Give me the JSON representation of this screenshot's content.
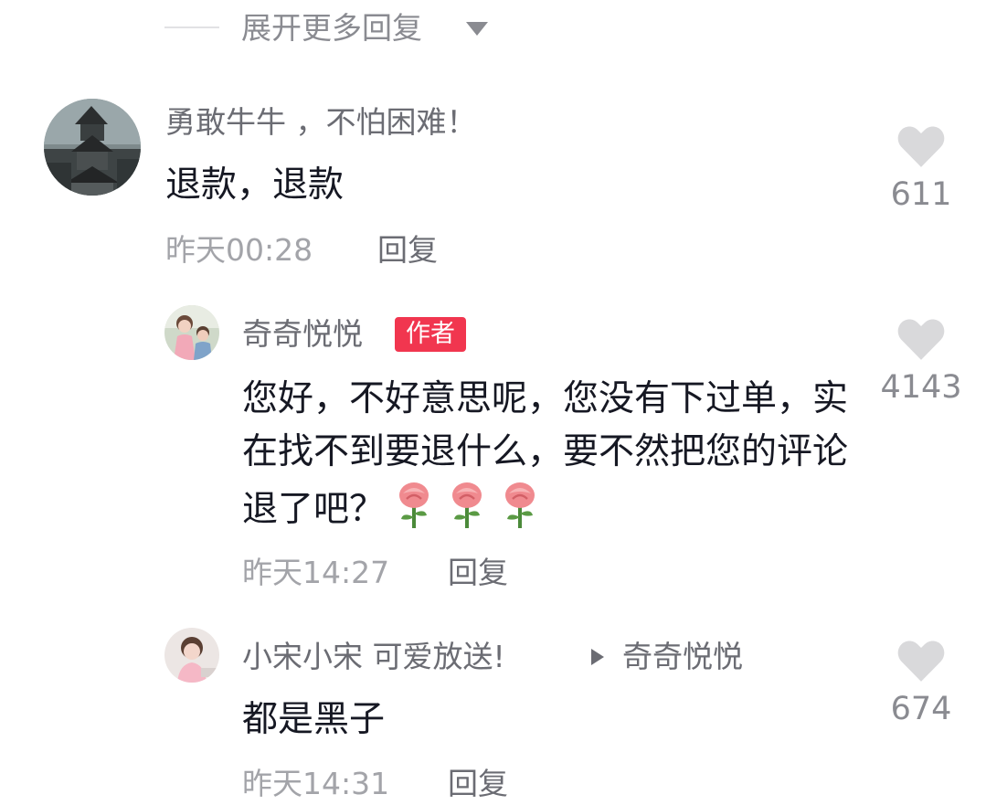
{
  "expand": {
    "label": "展开更多回复"
  },
  "comments": [
    {
      "username": "勇敢牛牛 ，不怕困难！",
      "text": "退款，退款",
      "time": "昨天00:28",
      "reply_label": "回复",
      "likes": "611"
    },
    {
      "username": "奇奇悦悦",
      "badge": "作者",
      "text": "您好，不好意思呢，您没有下过单，实在找不到要退什么，要不然把您的评论退了吧？",
      "time": "昨天14:27",
      "reply_label": "回复",
      "likes": "4143",
      "emoji": [
        "rose-icon",
        "rose-icon",
        "rose-icon"
      ]
    },
    {
      "username": "小宋小宋 可爱放送!",
      "reply_to": "奇奇悦悦",
      "text": "都是黑子",
      "time": "昨天14:31",
      "reply_label": "回复",
      "likes": "674"
    }
  ],
  "colors": {
    "badge": "#f1364f",
    "heart": "#d9d9db",
    "text": "#161823",
    "secondary": "#8a8b91"
  }
}
